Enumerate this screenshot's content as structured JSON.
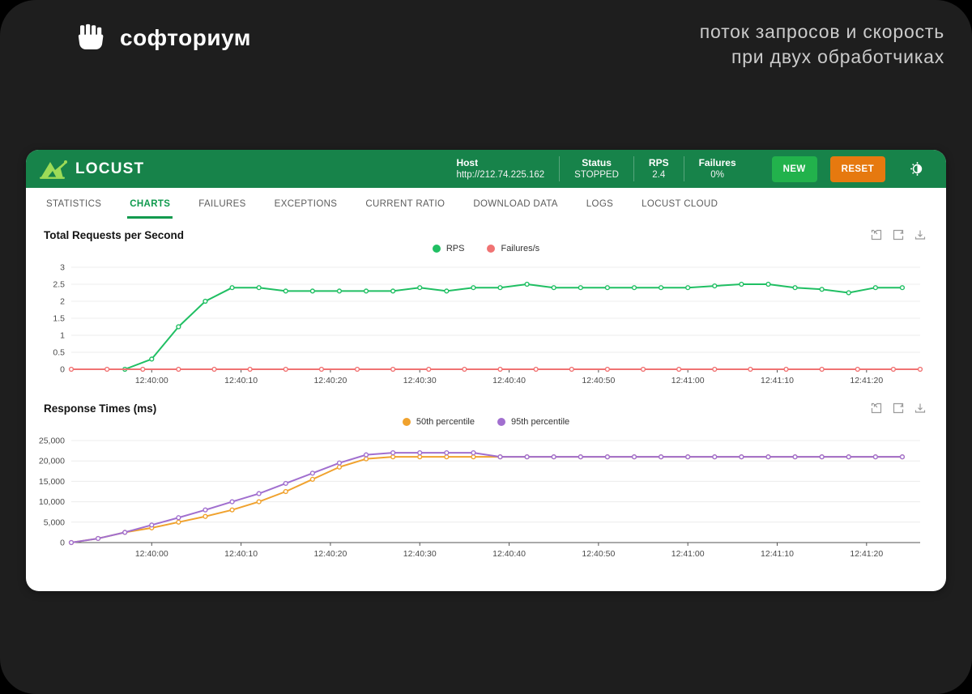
{
  "brand": {
    "name": "софториум"
  },
  "tagline": {
    "line1": "поток запросов и скорость",
    "line2": "при двух обработчиках"
  },
  "header": {
    "app_name": "LOCUST",
    "host_label": "Host",
    "host_value": "http://212.74.225.162",
    "status_label": "Status",
    "status_value": "STOPPED",
    "rps_label": "RPS",
    "rps_value": "2.4",
    "failures_label": "Failures",
    "failures_value": "0%",
    "new_button": "NEW",
    "reset_button": "RESET"
  },
  "tabs": [
    {
      "label": "STATISTICS",
      "active": false
    },
    {
      "label": "CHARTS",
      "active": true
    },
    {
      "label": "FAILURES",
      "active": false
    },
    {
      "label": "EXCEPTIONS",
      "active": false
    },
    {
      "label": "CURRENT RATIO",
      "active": false
    },
    {
      "label": "DOWNLOAD DATA",
      "active": false
    },
    {
      "label": "LOGS",
      "active": false
    },
    {
      "label": "LOCUST CLOUD",
      "active": false
    }
  ],
  "colors": {
    "header_green": "#17834a",
    "new_button_green": "#22b24c",
    "reset_button_orange": "#e6790f",
    "tab_active_green": "#129a4e",
    "rps_line": "#20bf63",
    "failures_line": "#f07373",
    "p50_line": "#f0a22e",
    "p95_line": "#a16fcf"
  },
  "chart_data": [
    {
      "type": "line",
      "title": "Total Requests per Second",
      "legend": [
        "RPS",
        "Failures/s"
      ],
      "legend_position": "top-center",
      "grid": true,
      "x_range": [
        "12:39:51",
        "12:41:26"
      ],
      "x_ticks": [
        "12:40:00",
        "12:40:10",
        "12:40:20",
        "12:40:30",
        "12:40:40",
        "12:40:50",
        "12:41:00",
        "12:41:10",
        "12:41:20"
      ],
      "ylim": [
        0,
        3
      ],
      "y_ticks": [
        0,
        0.5,
        1,
        1.5,
        2,
        2.5,
        3
      ],
      "y_format": "plain",
      "series": [
        {
          "name": "RPS",
          "color": "#20bf63",
          "points": [
            [
              "12:39:57",
              0
            ],
            [
              "12:40:00",
              0.3
            ],
            [
              "12:40:03",
              1.25
            ],
            [
              "12:40:06",
              2.0
            ],
            [
              "12:40:09",
              2.4
            ],
            [
              "12:40:12",
              2.4
            ],
            [
              "12:40:15",
              2.3
            ],
            [
              "12:40:18",
              2.3
            ],
            [
              "12:40:21",
              2.3
            ],
            [
              "12:40:24",
              2.3
            ],
            [
              "12:40:27",
              2.3
            ],
            [
              "12:40:30",
              2.4
            ],
            [
              "12:40:33",
              2.3
            ],
            [
              "12:40:36",
              2.4
            ],
            [
              "12:40:39",
              2.4
            ],
            [
              "12:40:42",
              2.5
            ],
            [
              "12:40:45",
              2.4
            ],
            [
              "12:40:48",
              2.4
            ],
            [
              "12:40:51",
              2.4
            ],
            [
              "12:40:54",
              2.4
            ],
            [
              "12:40:57",
              2.4
            ],
            [
              "12:41:00",
              2.4
            ],
            [
              "12:41:03",
              2.45
            ],
            [
              "12:41:06",
              2.5
            ],
            [
              "12:41:09",
              2.5
            ],
            [
              "12:41:12",
              2.4
            ],
            [
              "12:41:15",
              2.35
            ],
            [
              "12:41:18",
              2.25
            ],
            [
              "12:41:21",
              2.4
            ],
            [
              "12:41:24",
              2.4
            ]
          ]
        },
        {
          "name": "Failures/s",
          "color": "#f07373",
          "points": [
            [
              "12:39:51",
              0
            ],
            [
              "12:39:55",
              0
            ],
            [
              "12:39:59",
              0
            ],
            [
              "12:40:03",
              0
            ],
            [
              "12:40:07",
              0
            ],
            [
              "12:40:11",
              0
            ],
            [
              "12:40:15",
              0
            ],
            [
              "12:40:19",
              0
            ],
            [
              "12:40:23",
              0
            ],
            [
              "12:40:27",
              0
            ],
            [
              "12:40:31",
              0
            ],
            [
              "12:40:35",
              0
            ],
            [
              "12:40:39",
              0
            ],
            [
              "12:40:43",
              0
            ],
            [
              "12:40:47",
              0
            ],
            [
              "12:40:51",
              0
            ],
            [
              "12:40:55",
              0
            ],
            [
              "12:40:59",
              0
            ],
            [
              "12:41:03",
              0
            ],
            [
              "12:41:07",
              0
            ],
            [
              "12:41:11",
              0
            ],
            [
              "12:41:15",
              0
            ],
            [
              "12:41:19",
              0
            ],
            [
              "12:41:23",
              0
            ],
            [
              "12:41:26",
              0
            ]
          ]
        }
      ]
    },
    {
      "type": "line",
      "title": "Response Times (ms)",
      "legend": [
        "50th percentile",
        "95th percentile"
      ],
      "legend_position": "top-center",
      "grid": true,
      "x_range": [
        "12:39:51",
        "12:41:26"
      ],
      "x_ticks": [
        "12:40:00",
        "12:40:10",
        "12:40:20",
        "12:40:30",
        "12:40:40",
        "12:40:50",
        "12:41:00",
        "12:41:10",
        "12:41:20"
      ],
      "ylim": [
        0,
        25000
      ],
      "y_ticks": [
        0,
        5000,
        10000,
        15000,
        20000,
        25000
      ],
      "y_format": "thousands",
      "series": [
        {
          "name": "50th percentile",
          "color": "#f0a22e",
          "points": [
            [
              "12:39:51",
              0
            ],
            [
              "12:39:54",
              1000
            ],
            [
              "12:39:57",
              2500
            ],
            [
              "12:40:00",
              3600
            ],
            [
              "12:40:03",
              5000
            ],
            [
              "12:40:06",
              6400
            ],
            [
              "12:40:09",
              8000
            ],
            [
              "12:40:12",
              10000
            ],
            [
              "12:40:15",
              12500
            ],
            [
              "12:40:18",
              15500
            ],
            [
              "12:40:21",
              18500
            ],
            [
              "12:40:24",
              20500
            ],
            [
              "12:40:27",
              21000
            ],
            [
              "12:40:30",
              21000
            ],
            [
              "12:40:33",
              21000
            ],
            [
              "12:40:36",
              21000
            ],
            [
              "12:40:39",
              21000
            ],
            [
              "12:40:42",
              21000
            ],
            [
              "12:40:45",
              21000
            ],
            [
              "12:40:48",
              21000
            ],
            [
              "12:40:51",
              21000
            ],
            [
              "12:40:54",
              21000
            ],
            [
              "12:40:57",
              21000
            ],
            [
              "12:41:00",
              21000
            ],
            [
              "12:41:03",
              21000
            ],
            [
              "12:41:06",
              21000
            ],
            [
              "12:41:09",
              21000
            ],
            [
              "12:41:12",
              21000
            ],
            [
              "12:41:15",
              21000
            ],
            [
              "12:41:18",
              21000
            ],
            [
              "12:41:21",
              21000
            ],
            [
              "12:41:24",
              21000
            ]
          ]
        },
        {
          "name": "95th percentile",
          "color": "#a16fcf",
          "points": [
            [
              "12:39:51",
              0
            ],
            [
              "12:39:54",
              1000
            ],
            [
              "12:39:57",
              2500
            ],
            [
              "12:40:00",
              4300
            ],
            [
              "12:40:03",
              6100
            ],
            [
              "12:40:06",
              8000
            ],
            [
              "12:40:09",
              10000
            ],
            [
              "12:40:12",
              12000
            ],
            [
              "12:40:15",
              14500
            ],
            [
              "12:40:18",
              17000
            ],
            [
              "12:40:21",
              19500
            ],
            [
              "12:40:24",
              21500
            ],
            [
              "12:40:27",
              22000
            ],
            [
              "12:40:30",
              22000
            ],
            [
              "12:40:33",
              22000
            ],
            [
              "12:40:36",
              22000
            ],
            [
              "12:40:39",
              21000
            ],
            [
              "12:40:42",
              21000
            ],
            [
              "12:40:45",
              21000
            ],
            [
              "12:40:48",
              21000
            ],
            [
              "12:40:51",
              21000
            ],
            [
              "12:40:54",
              21000
            ],
            [
              "12:40:57",
              21000
            ],
            [
              "12:41:00",
              21000
            ],
            [
              "12:41:03",
              21000
            ],
            [
              "12:41:06",
              21000
            ],
            [
              "12:41:09",
              21000
            ],
            [
              "12:41:12",
              21000
            ],
            [
              "12:41:15",
              21000
            ],
            [
              "12:41:18",
              21000
            ],
            [
              "12:41:21",
              21000
            ],
            [
              "12:41:24",
              21000
            ]
          ]
        }
      ]
    }
  ]
}
